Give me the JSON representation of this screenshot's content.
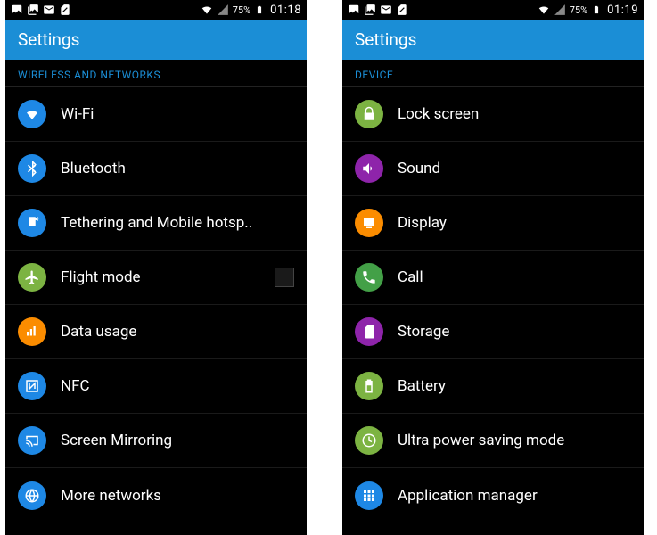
{
  "left": {
    "statusbar": {
      "battery": "75%",
      "time": "01:18"
    },
    "title": "Settings",
    "section": "WIRELESS AND NETWORKS",
    "items": [
      {
        "name": "wifi",
        "label": "Wi-Fi",
        "color": "#1e88e5",
        "icon": "wifi"
      },
      {
        "name": "bluetooth",
        "label": "Bluetooth",
        "color": "#1e88e5",
        "icon": "bluetooth"
      },
      {
        "name": "tethering",
        "label": "Tethering and Mobile hotsp..",
        "color": "#1e88e5",
        "icon": "hotspot"
      },
      {
        "name": "flight-mode",
        "label": "Flight mode",
        "color": "#7cb342",
        "icon": "airplane",
        "checkbox": true
      },
      {
        "name": "data-usage",
        "label": "Data usage",
        "color": "#fb8c00",
        "icon": "bars"
      },
      {
        "name": "nfc",
        "label": "NFC",
        "color": "#1e88e5",
        "icon": "nfc"
      },
      {
        "name": "screen-mirror",
        "label": "Screen Mirroring",
        "color": "#1e88e5",
        "icon": "cast"
      },
      {
        "name": "more-networks",
        "label": "More networks",
        "color": "#1e88e5",
        "icon": "globe"
      }
    ]
  },
  "right": {
    "statusbar": {
      "battery": "75%",
      "time": "01:19"
    },
    "title": "Settings",
    "section": "DEVICE",
    "items": [
      {
        "name": "lock-screen",
        "label": "Lock screen",
        "color": "#7cb342",
        "icon": "lock"
      },
      {
        "name": "sound",
        "label": "Sound",
        "color": "#8e24aa",
        "icon": "sound"
      },
      {
        "name": "display",
        "label": "Display",
        "color": "#fb8c00",
        "icon": "display"
      },
      {
        "name": "call",
        "label": "Call",
        "color": "#43a047",
        "icon": "phone"
      },
      {
        "name": "storage",
        "label": "Storage",
        "color": "#8e24aa",
        "icon": "sd"
      },
      {
        "name": "battery",
        "label": "Battery",
        "color": "#7cb342",
        "icon": "battery"
      },
      {
        "name": "ultra-power",
        "label": "Ultra power saving mode",
        "color": "#7cb342",
        "icon": "ups"
      },
      {
        "name": "app-manager",
        "label": "Application manager",
        "color": "#1e88e5",
        "icon": "apps"
      }
    ]
  }
}
